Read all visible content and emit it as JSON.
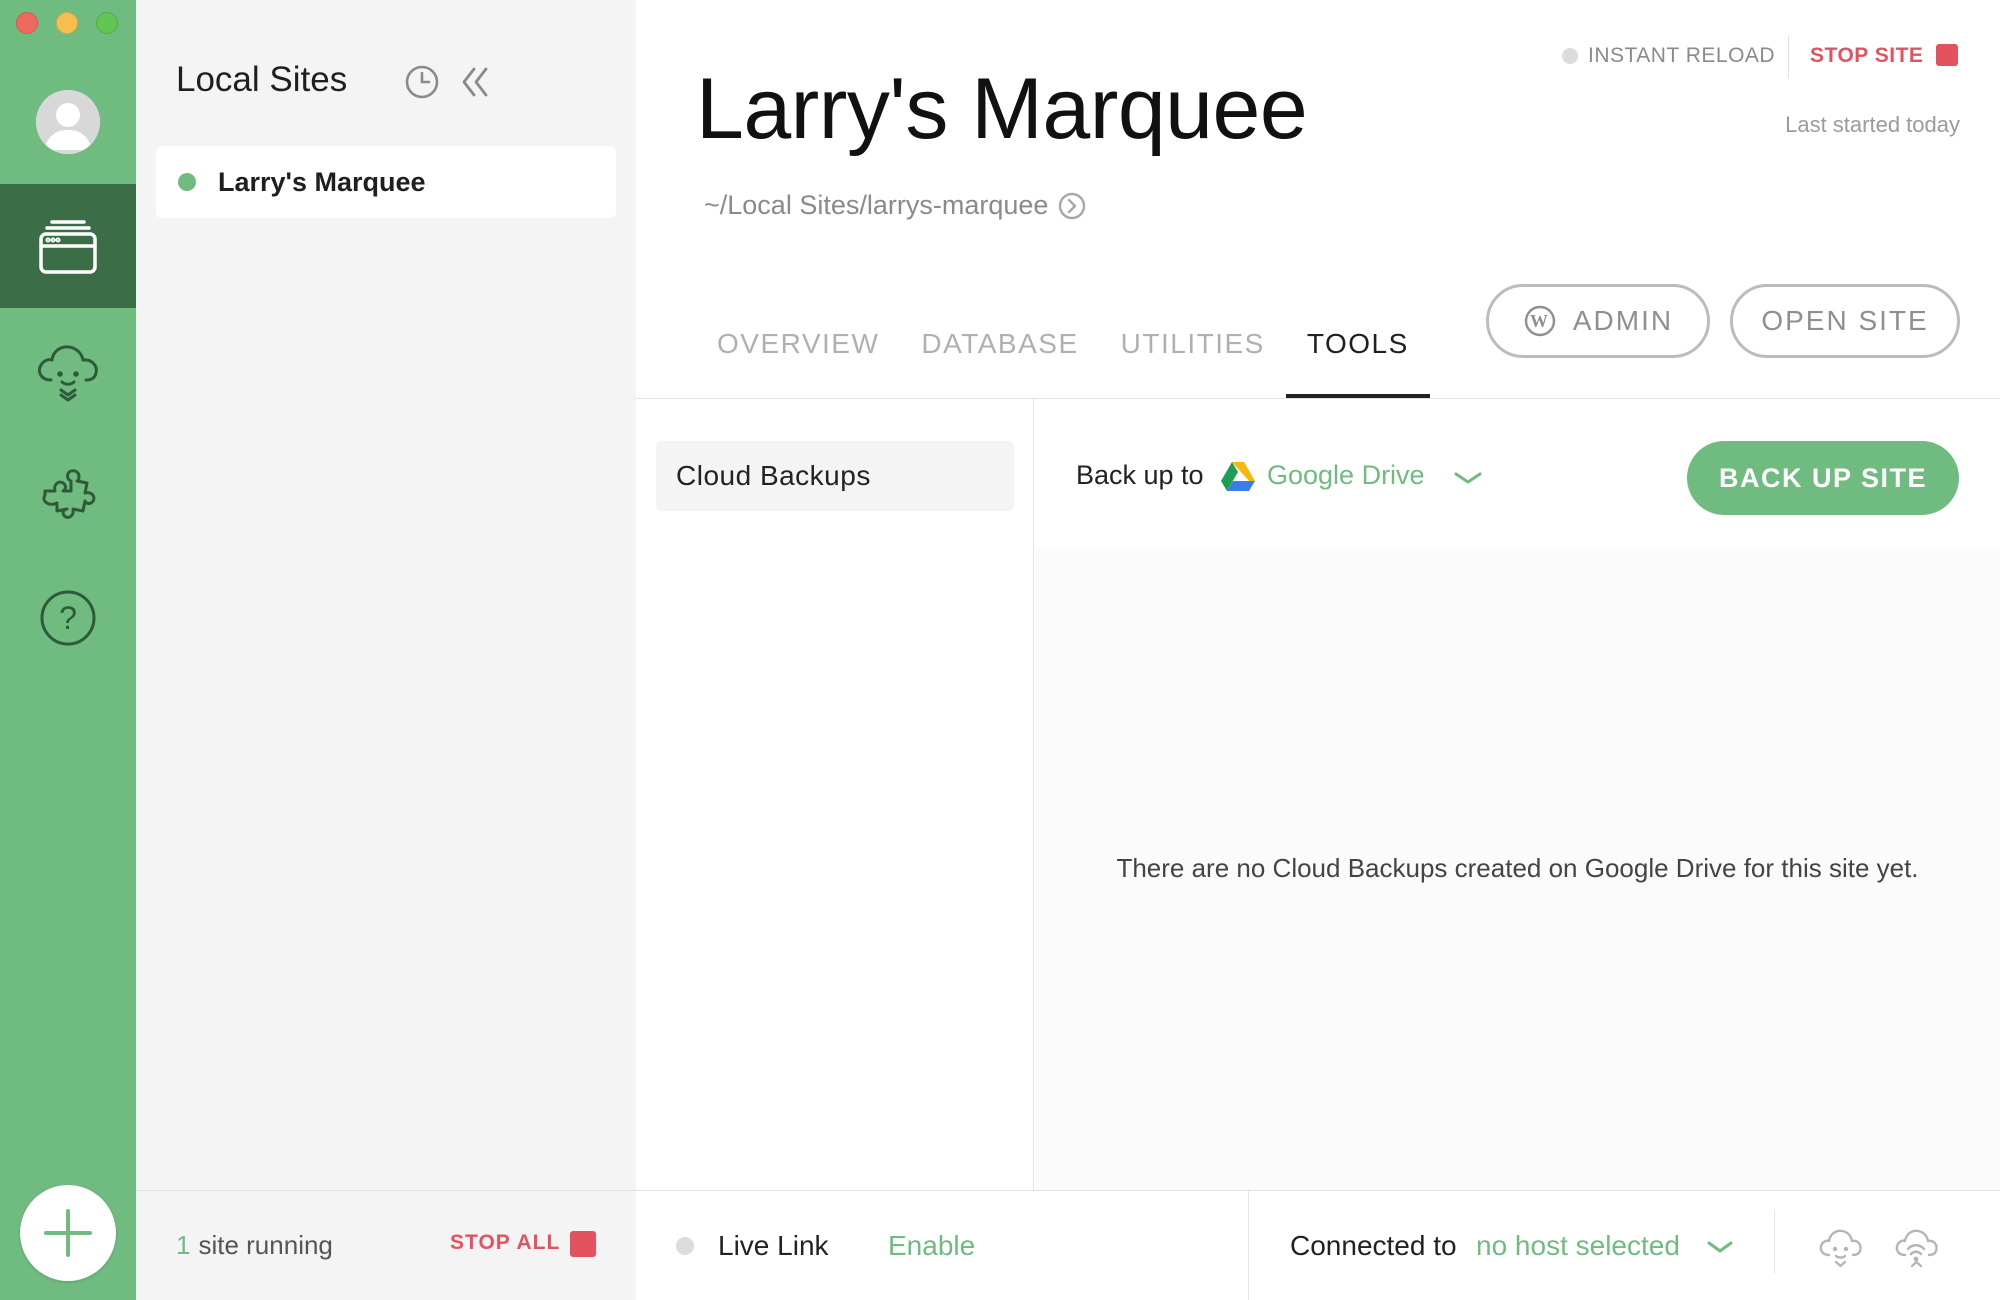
{
  "rail": {
    "icons": [
      "avatar",
      "sites-icon",
      "cloud-download-icon",
      "puzzle-icon",
      "help-icon",
      "add-icon"
    ]
  },
  "sites_panel": {
    "title": "Local Sites",
    "sites": [
      {
        "name": "Larry's Marquee",
        "status": "running"
      }
    ],
    "footer": {
      "count": "1",
      "running_text": "site running",
      "stop_all": "STOP ALL"
    }
  },
  "header": {
    "instant_reload": "INSTANT RELOAD",
    "stop_site": "STOP SITE",
    "last_started": "Last started today",
    "site_title": "Larry's Marquee",
    "site_path": "~/Local Sites/larrys-marquee"
  },
  "tabs": [
    {
      "label": "OVERVIEW",
      "active": false
    },
    {
      "label": "DATABASE",
      "active": false
    },
    {
      "label": "UTILITIES",
      "active": false
    },
    {
      "label": "TOOLS",
      "active": true
    }
  ],
  "actions": {
    "admin": "ADMIN",
    "open_site": "OPEN SITE"
  },
  "tools": {
    "menu": [
      "Cloud Backups"
    ],
    "backup_label": "Back up to",
    "provider": "Google Drive",
    "backup_button": "BACK UP SITE",
    "empty_message": "There are no Cloud Backups created on Google Drive for this site yet."
  },
  "footer": {
    "live_link_label": "Live Link",
    "live_link_action": "Enable",
    "connected_label": "Connected to",
    "host": "no host selected"
  },
  "colors": {
    "brand_green": "#6fbb80",
    "rail_active": "#3b6e47",
    "stop_red": "#e3535f",
    "panel_gray": "#f4f4f4"
  }
}
